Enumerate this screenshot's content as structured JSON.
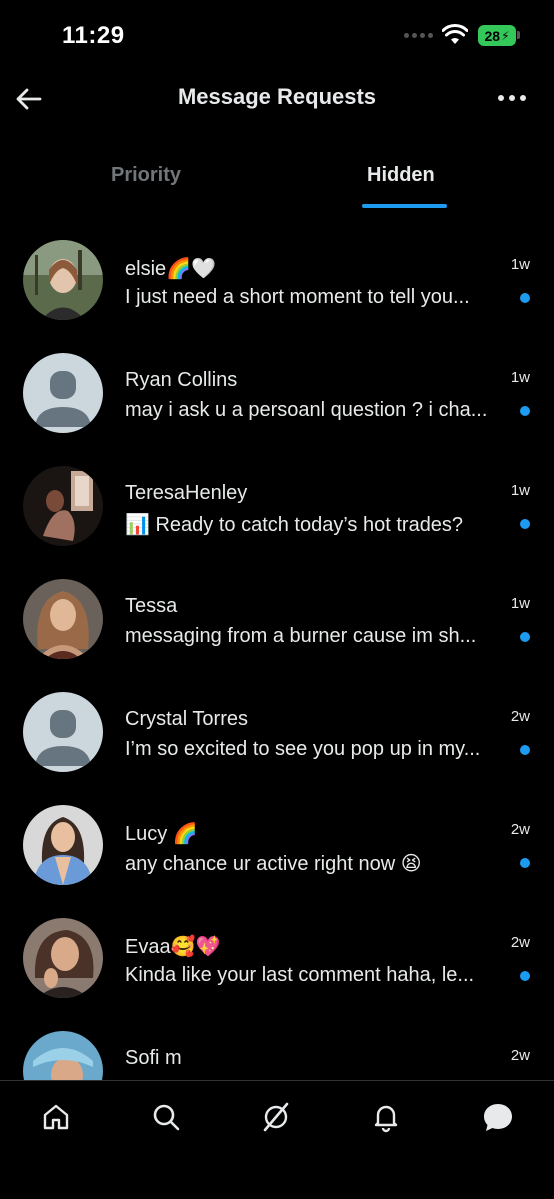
{
  "status_bar": {
    "time": "11:29",
    "battery": "28"
  },
  "header": {
    "title": "Message Requests",
    "back_icon": "arrow-left-icon",
    "more_icon": "more-horizontal-icon"
  },
  "tabs": [
    {
      "label": "Priority",
      "active": false
    },
    {
      "label": "Hidden",
      "active": true
    }
  ],
  "conversations": [
    {
      "name": "elsie🌈🤍",
      "preview": "I just need a short moment to tell you...",
      "time": "1w",
      "unread": true,
      "avatar": "photo"
    },
    {
      "name": "Ryan Collins",
      "preview": "may i ask u a persoanl question ? i cha...",
      "time": "1w",
      "unread": true,
      "avatar": "default"
    },
    {
      "name": "TeresaHenley",
      "preview": "📊 Ready to catch today’s hot trades?",
      "time": "1w",
      "unread": true,
      "avatar": "photo"
    },
    {
      "name": "Tessa",
      "preview": "messaging from a burner cause im sh...",
      "time": "1w",
      "unread": true,
      "avatar": "photo"
    },
    {
      "name": "Crystal Torres",
      "preview": "I’m so excited to see you pop up in my...",
      "time": "2w",
      "unread": true,
      "avatar": "default"
    },
    {
      "name": "Lucy 🌈",
      "preview": "any chance ur active right now 😫",
      "time": "2w",
      "unread": true,
      "avatar": "photo"
    },
    {
      "name": "Evaa🥰💖",
      "preview": "Kinda like your last comment haha, le...",
      "time": "2w",
      "unread": true,
      "avatar": "photo"
    },
    {
      "name": "Sofi m",
      "preview": "",
      "time": "2w",
      "unread": false,
      "avatar": "photo"
    }
  ],
  "bottom_nav": [
    {
      "name": "home-icon"
    },
    {
      "name": "search-icon"
    },
    {
      "name": "grok-icon"
    },
    {
      "name": "bell-icon"
    },
    {
      "name": "messages-icon"
    }
  ],
  "colors": {
    "accent": "#1d9bf0",
    "background": "#000000",
    "muted": "#71767b"
  }
}
